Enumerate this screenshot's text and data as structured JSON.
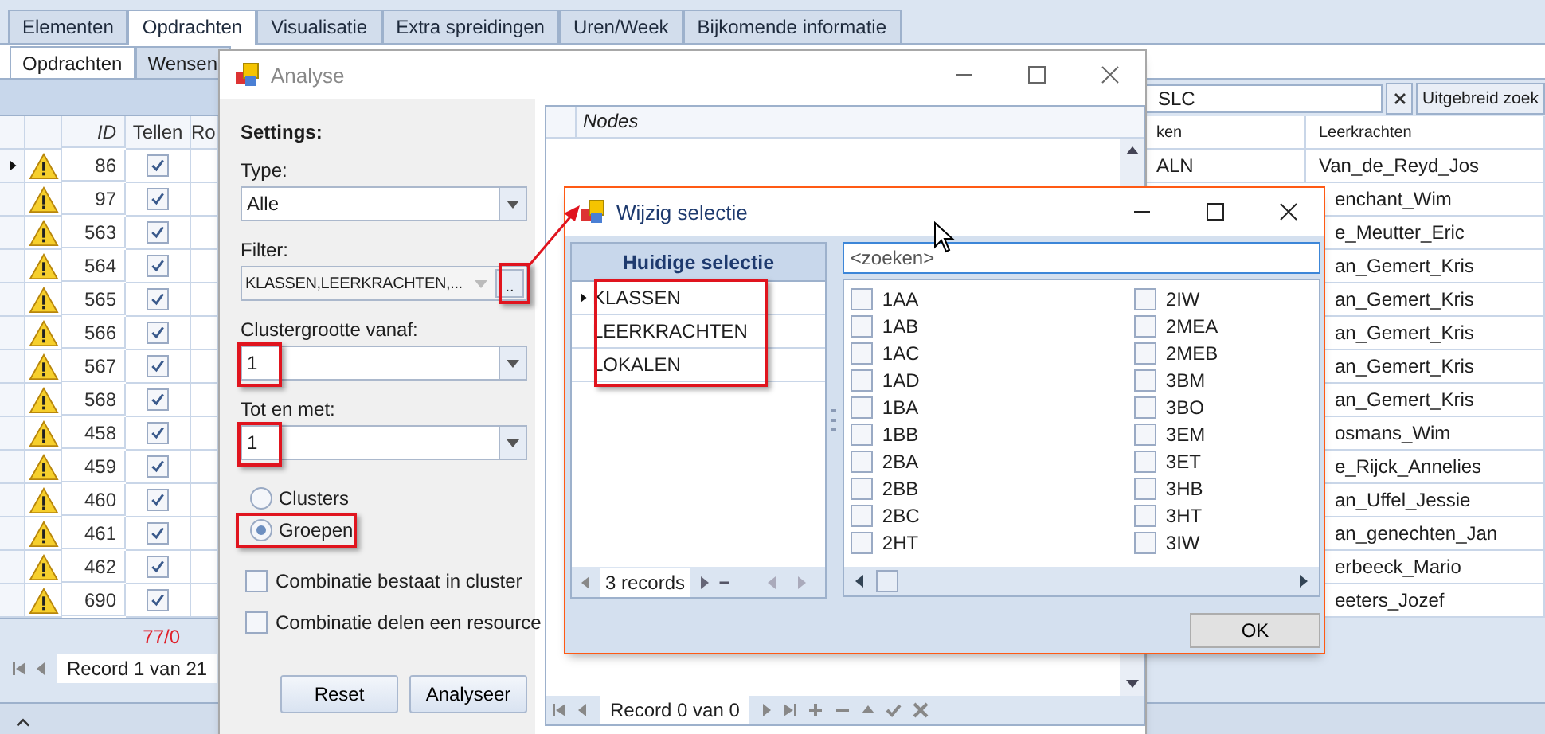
{
  "main_tabs": [
    {
      "label": "Elementen",
      "selected": false
    },
    {
      "label": "Opdrachten",
      "selected": true
    },
    {
      "label": "Visualisatie",
      "selected": false
    },
    {
      "label": "Extra spreidingen",
      "selected": false
    },
    {
      "label": "Uren/Week",
      "selected": false
    },
    {
      "label": "Bijkomende informatie",
      "selected": false
    }
  ],
  "sub_tabs": [
    {
      "label": "Opdrachten",
      "selected": true
    },
    {
      "label": "Wensen",
      "selected": false
    }
  ],
  "grid": {
    "columns": [
      "ID",
      "Tellen",
      "Ro"
    ],
    "rows": [
      {
        "id": "86",
        "counted": true,
        "current": true
      },
      {
        "id": "97",
        "counted": true,
        "current": false
      },
      {
        "id": "563",
        "counted": true,
        "current": false
      },
      {
        "id": "564",
        "counted": true,
        "current": false
      },
      {
        "id": "565",
        "counted": true,
        "current": false
      },
      {
        "id": "566",
        "counted": true,
        "current": false
      },
      {
        "id": "567",
        "counted": true,
        "current": false
      },
      {
        "id": "568",
        "counted": true,
        "current": false
      },
      {
        "id": "458",
        "counted": true,
        "current": false
      },
      {
        "id": "459",
        "counted": true,
        "current": false
      },
      {
        "id": "460",
        "counted": true,
        "current": false
      },
      {
        "id": "461",
        "counted": true,
        "current": false
      },
      {
        "id": "462",
        "counted": true,
        "current": false
      },
      {
        "id": "690",
        "counted": true,
        "current": false
      }
    ],
    "footer_total": "77/0",
    "navigator": "Record 1 van 21"
  },
  "right_grid": {
    "search_value": "SLC",
    "advanced_search_button": "Uitgebreid zoek",
    "columns": [
      "ken",
      "Leerkrachten"
    ],
    "rows": [
      {
        "column_1": "ALN",
        "leerkrachten": "Van_de_Reyd_Jos"
      },
      {
        "leerkrachten": "enchant_Wim"
      },
      {
        "leerkrachten": "e_Meutter_Eric"
      },
      {
        "leerkrachten": "an_Gemert_Kris"
      },
      {
        "leerkrachten": "an_Gemert_Kris"
      },
      {
        "leerkrachten": "an_Gemert_Kris"
      },
      {
        "leerkrachten": "an_Gemert_Kris"
      },
      {
        "leerkrachten": "an_Gemert_Kris"
      },
      {
        "leerkrachten": "osmans_Wim"
      },
      {
        "leerkrachten": "e_Rijck_Annelies"
      },
      {
        "leerkrachten": "an_Uffel_Jessie"
      },
      {
        "leerkrachten": "an_genechten_Jan"
      },
      {
        "leerkrachten": "erbeeck_Mario"
      },
      {
        "leerkrachten": "eeters_Jozef"
      }
    ]
  },
  "analyse_dialog": {
    "title": "Analyse",
    "settings_heading": "Settings:",
    "type_label": "Type:",
    "type_value": "Alle",
    "filter_label": "Filter:",
    "filter_value": "KLASSEN,LEERKRACHTEN,...",
    "filter_button": "..",
    "filter_button_highlighted": true,
    "cluster_from_label": "Clustergrootte vanaf:",
    "cluster_from_value": "1",
    "cluster_from_highlighted": true,
    "cluster_to_label": "Tot en met:",
    "cluster_to_value": "1",
    "cluster_to_highlighted": true,
    "modes": [
      {
        "label": "Clusters",
        "selected": false,
        "highlighted": false
      },
      {
        "label": "Groepen",
        "selected": true,
        "highlighted": true
      }
    ],
    "options": [
      {
        "label": "Combinatie bestaat in cluster",
        "checked": false
      },
      {
        "label": "Combinatie delen een resource",
        "checked": false
      }
    ],
    "buttons": [
      "Reset",
      "Analyseer"
    ],
    "nodes_header": "Nodes",
    "nodes_navigator": "Record 0 van 0"
  },
  "selection_dialog": {
    "title": "Wijzig selectie",
    "current_header": "Huidige selectie",
    "current_highlighted": true,
    "current_items": [
      {
        "label": "KLASSEN",
        "current": true
      },
      {
        "label": "LEERKRACHTEN",
        "current": false
      },
      {
        "label": "LOKALEN",
        "current": false
      }
    ],
    "record_count": "3 records",
    "search_placeholder": "<zoeken>",
    "items": [
      {
        "label": "1AA",
        "checked": false
      },
      {
        "label": "1AB",
        "checked": false
      },
      {
        "label": "1AC",
        "checked": false
      },
      {
        "label": "1AD",
        "checked": false
      },
      {
        "label": "1BA",
        "checked": false
      },
      {
        "label": "1BB",
        "checked": false
      },
      {
        "label": "2BA",
        "checked": false
      },
      {
        "label": "2BB",
        "checked": false
      },
      {
        "label": "2BC",
        "checked": false
      },
      {
        "label": "2HT",
        "checked": false
      },
      {
        "label": "2IW",
        "checked": false
      },
      {
        "label": "2MEA",
        "checked": false
      },
      {
        "label": "2MEB",
        "checked": false
      },
      {
        "label": "3BM",
        "checked": false
      },
      {
        "label": "3BO",
        "checked": false
      },
      {
        "label": "3EM",
        "checked": false
      },
      {
        "label": "3ET",
        "checked": false
      },
      {
        "label": "3HB",
        "checked": false
      },
      {
        "label": "3HT",
        "checked": false
      },
      {
        "label": "3IW",
        "checked": false
      }
    ],
    "ok_button": "OK"
  }
}
